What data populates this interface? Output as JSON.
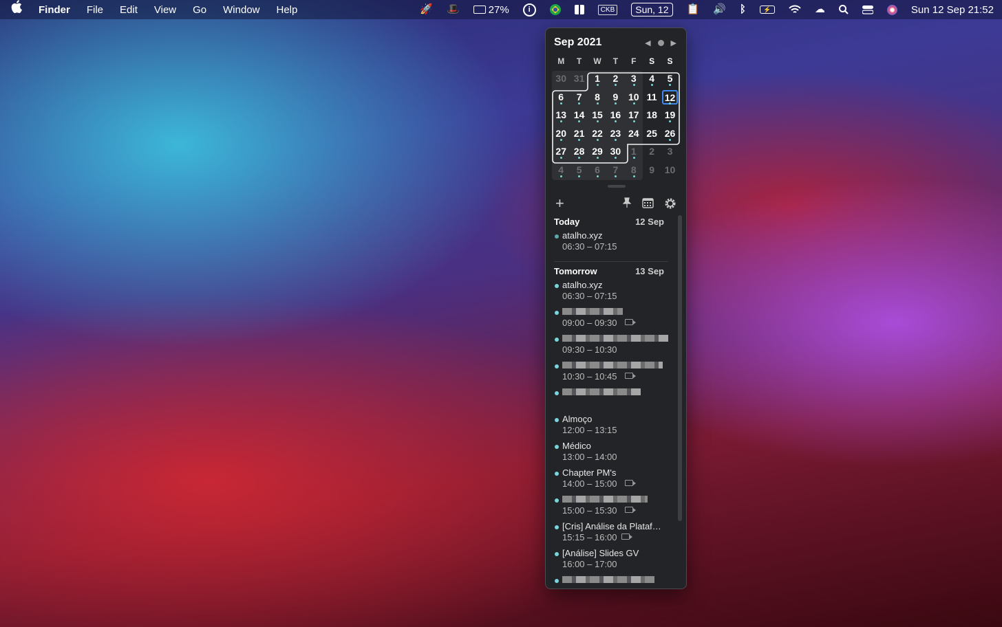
{
  "menubar": {
    "app_name": "Finder",
    "menus": [
      "File",
      "Edit",
      "View",
      "Go",
      "Window",
      "Help"
    ],
    "battery_percent": "27%",
    "keyboard_badge": "CKB",
    "date_badge": "Sun, 12",
    "clock": "Sun 12 Sep  21:52"
  },
  "calendar": {
    "title": "Sep 2021",
    "weekdays": [
      "M",
      "T",
      "W",
      "T",
      "F",
      "S",
      "S"
    ],
    "today": "12",
    "days": [
      "30",
      "31",
      "1",
      "2",
      "3",
      "4",
      "5",
      "6",
      "7",
      "8",
      "9",
      "10",
      "11",
      "12",
      "13",
      "14",
      "15",
      "16",
      "17",
      "18",
      "19",
      "20",
      "21",
      "22",
      "23",
      "24",
      "25",
      "26",
      "27",
      "28",
      "29",
      "30",
      "1",
      "2",
      "3",
      "4",
      "5",
      "6",
      "7",
      "8",
      "9",
      "10"
    ]
  },
  "agenda": {
    "today": {
      "label": "Today",
      "date": "12 Sep"
    },
    "tomorrow": {
      "label": "Tomorrow",
      "date": "13 Sep"
    },
    "today_events": [
      {
        "title": "atalho.xyz",
        "time": "06:30 – 07:15"
      }
    ],
    "tomorrow_events": [
      {
        "title": "atalho.xyz",
        "time": "06:30 – 07:15"
      },
      {
        "title": "",
        "time": "09:00 – 09:30"
      },
      {
        "title": "",
        "time": "09:30 – 10:30"
      },
      {
        "title": "",
        "time": "10:30 – 10:45"
      },
      {
        "title": "",
        "time": ""
      },
      {
        "title": "Almoço",
        "time": "12:00 – 13:15"
      },
      {
        "title": "Médico",
        "time": "13:00 – 14:00"
      },
      {
        "title": "Chapter PM's",
        "time": "14:00 – 15:00"
      },
      {
        "title": "",
        "time": "15:00 – 15:30"
      },
      {
        "title": "[Cris] Análise da Plataf…",
        "time": "15:15 – 16:00"
      },
      {
        "title": "[Análise] Slides GV",
        "time": "16:00 – 17:00"
      },
      {
        "title": "",
        "time": ""
      }
    ]
  },
  "icons": {
    "apple": "apple-logo-icon",
    "add": "plus-icon",
    "pin": "pin-icon",
    "calendar": "calendar-icon",
    "settings": "gear-icon"
  },
  "colors": {
    "today_highlight": "#3b8bf2",
    "event_dot": "#78d6dc",
    "popover_bg": "#232427"
  }
}
